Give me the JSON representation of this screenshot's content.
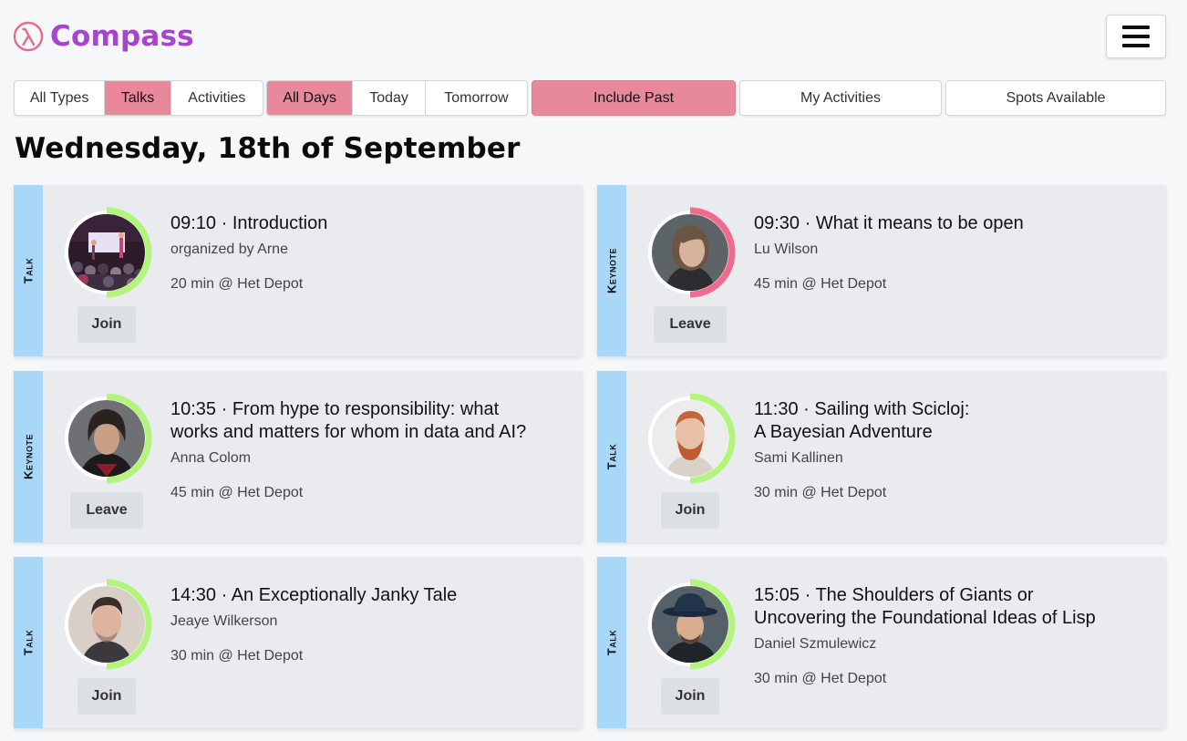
{
  "app": {
    "name": "Compass",
    "brand_color": "#a845cf",
    "logo_icon": "lambda-circle-icon"
  },
  "menu": {
    "icon": "hamburger-menu-icon"
  },
  "filters": {
    "type_group": [
      {
        "label": "All Types",
        "active": false
      },
      {
        "label": "Talks",
        "active": true
      },
      {
        "label": "Activities",
        "active": false
      }
    ],
    "day_group": [
      {
        "label": "All Days",
        "active": true
      },
      {
        "label": "Today",
        "active": false
      },
      {
        "label": "Tomorrow",
        "active": false
      }
    ],
    "include_past": {
      "label": "Include Past",
      "active": true
    },
    "my_activities": {
      "label": "My Activities",
      "active": false
    },
    "spots_available": {
      "label": "Spots Available",
      "active": false
    },
    "active_color": "#e8889b"
  },
  "day_heading": "Wednesday, 18th of September",
  "sessions": [
    {
      "kind": "Talk",
      "title": "09:10 · Introduction",
      "subtitle": "organized by Arne",
      "meta": "20 min @ Het Depot",
      "action": "Join",
      "ring_color": "#b3f57c",
      "ring_fraction": 0.5
    },
    {
      "kind": "Keynote",
      "title": "09:30 · What it means to be open",
      "subtitle": "Lu Wilson",
      "meta": "45 min @ Het Depot",
      "action": "Leave",
      "ring_color": "#f26b8f",
      "ring_fraction": 0.5
    },
    {
      "kind": "Keynote",
      "title_lines": [
        "10:35 · From hype to responsibility: what",
        "works and matters for whom in data and AI?"
      ],
      "subtitle": "Anna Colom",
      "meta": "45 min @ Het Depot",
      "action": "Leave",
      "ring_color": "#b3f57c",
      "ring_fraction": 0.5
    },
    {
      "kind": "Talk",
      "title_lines": [
        "11:30 · Sailing with Scicloj:",
        "A Bayesian Adventure"
      ],
      "subtitle": "Sami Kallinen",
      "meta": "30 min @ Het Depot",
      "action": "Join",
      "ring_color": "#b3f57c",
      "ring_fraction": 0.5
    },
    {
      "kind": "Talk",
      "title": "14:30 · An Exceptionally Janky Tale",
      "subtitle": "Jeaye Wilkerson",
      "meta": "30 min @ Het Depot",
      "action": "Join",
      "ring_color": "#b3f57c",
      "ring_fraction": 0.5
    },
    {
      "kind": "Talk",
      "title_lines": [
        "15:05 · The Shoulders of Giants or",
        "Uncovering the Foundational Ideas of Lisp"
      ],
      "subtitle": "Daniel Szmulewicz",
      "meta": "30 min @ Het Depot",
      "action": "Join",
      "ring_color": "#b3f57c",
      "ring_fraction": 0.5
    }
  ],
  "stripe_color": "#a9d7f7"
}
